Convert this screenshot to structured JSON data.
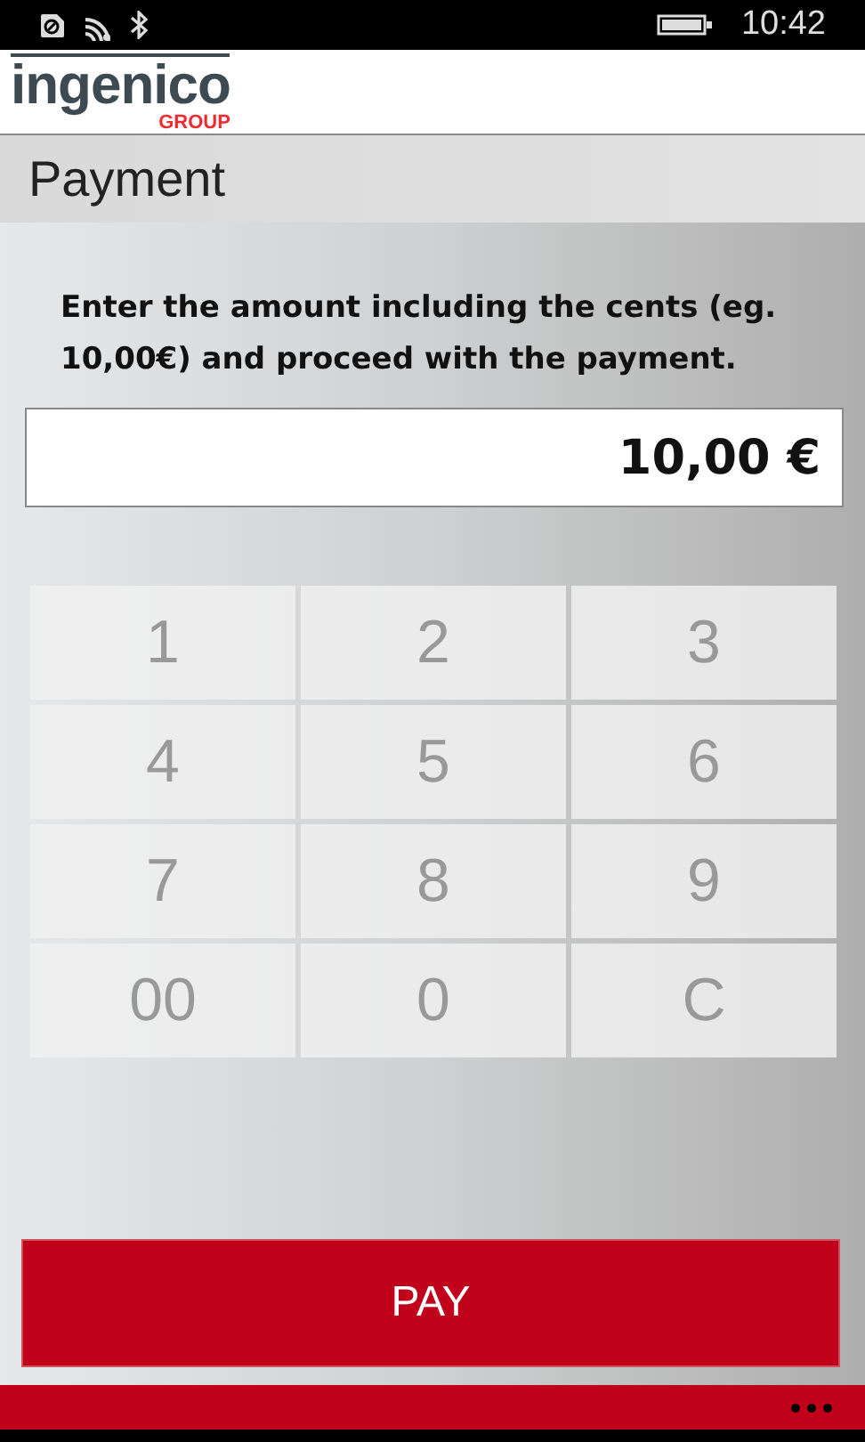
{
  "status_bar": {
    "time": "10:42"
  },
  "logo": {
    "name": "ingenico",
    "tagline": "GROUP"
  },
  "page_title": "Payment",
  "instruction": "Enter the amount including the cents (eg. 10,00€) and proceed with the payment.",
  "amount": {
    "value": "10,00 €"
  },
  "keypad": [
    {
      "label": "1"
    },
    {
      "label": "2"
    },
    {
      "label": "3"
    },
    {
      "label": "4"
    },
    {
      "label": "5"
    },
    {
      "label": "6"
    },
    {
      "label": "7"
    },
    {
      "label": "8"
    },
    {
      "label": "9"
    },
    {
      "label": "00"
    },
    {
      "label": "0"
    },
    {
      "label": "C"
    }
  ],
  "pay_button": "PAY"
}
